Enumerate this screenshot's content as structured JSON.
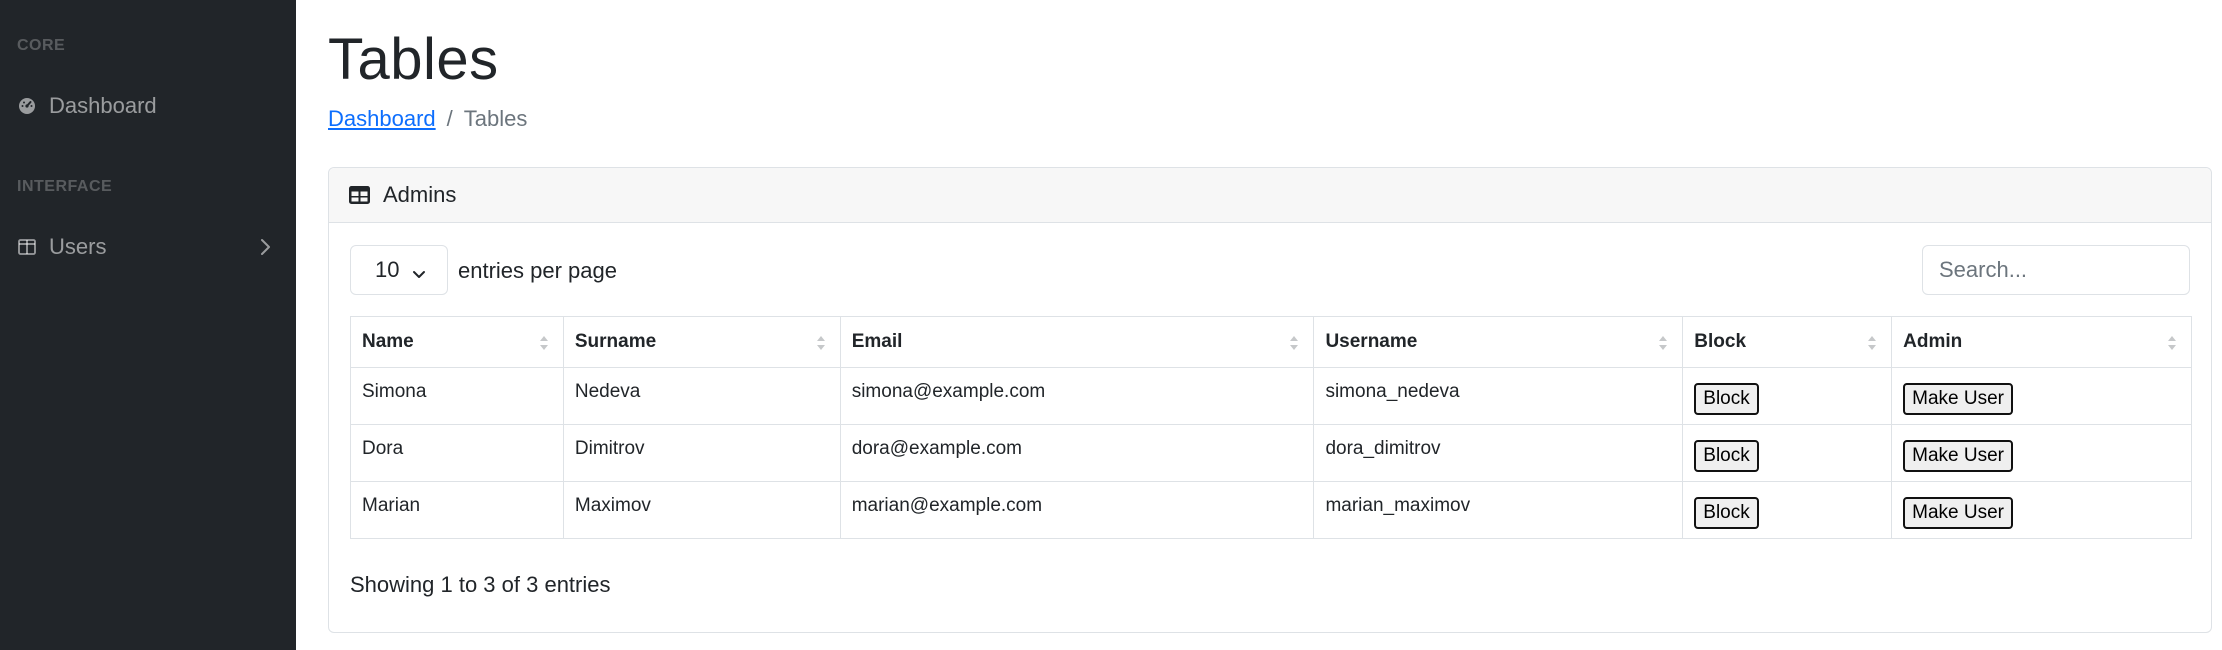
{
  "sidebar": {
    "core_heading": "CORE",
    "dashboard_label": "Dashboard",
    "interface_heading": "INTERFACE",
    "users_label": "Users"
  },
  "page": {
    "title": "Tables",
    "breadcrumb": {
      "link": "Dashboard",
      "separator": "/",
      "current": "Tables"
    }
  },
  "card": {
    "title": "Admins",
    "per_page_value": "10",
    "per_page_label": "entries per page",
    "search_placeholder": "Search...",
    "columns": [
      "Name",
      "Surname",
      "Email",
      "Username",
      "Block",
      "Admin"
    ],
    "rows": [
      {
        "name": "Simona",
        "surname": "Nedeva",
        "email": "simona@example.com",
        "username": "simona_nedeva",
        "block_label": "Block",
        "admin_label": "Make User"
      },
      {
        "name": "Dora",
        "surname": "Dimitrov",
        "email": "dora@example.com",
        "username": "dora_dimitrov",
        "block_label": "Block",
        "admin_label": "Make User"
      },
      {
        "name": "Marian",
        "surname": "Maximov",
        "email": "marian@example.com",
        "username": "marian_maximov",
        "block_label": "Block",
        "admin_label": "Make User"
      }
    ],
    "info": "Showing 1 to 3 of 3 entries"
  },
  "colors": {
    "sidebar_bg": "#212529",
    "link": "#0d6efd",
    "muted": "#6c757d",
    "border": "#dee2e6"
  },
  "icons": {
    "dashboard": "tachometer-icon",
    "users": "columns-icon",
    "card": "table-icon"
  }
}
